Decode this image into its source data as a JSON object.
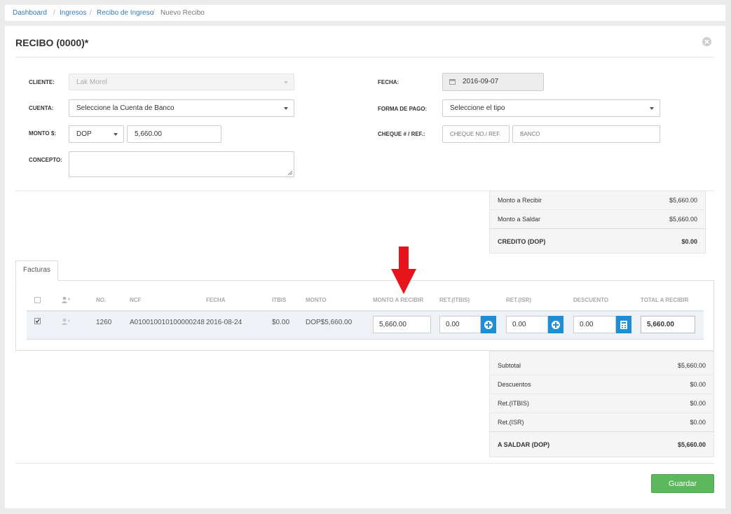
{
  "breadcrumb": [
    {
      "label": "Dashboard"
    },
    {
      "label": "Ingresos"
    },
    {
      "label": "Recibo de Ingreso"
    },
    {
      "label": "Nuevo Recibo"
    }
  ],
  "breadcrumb_separator": "/",
  "title": "RECIBO (0000)*",
  "form": {
    "cliente_label": "CLIENTE:",
    "cliente_value": "Lak Morel",
    "cuenta_label": "CUENTA:",
    "cuenta_value": "Seleccione la Cuenta de Banco",
    "monto_label": "MONTO $:",
    "currency_value": "DOP",
    "monto_value": "5,660.00",
    "concepto_label": "CONCEPTO:",
    "fecha_label": "FECHA:",
    "fecha_value": "2016-09-07",
    "forma_label": "FORMA DE PAGO:",
    "forma_value": "Seleccione el tipo",
    "cheque_label": "CHEQUE # / REF.:",
    "cheque_placeholder": "CHEQUE NO./ REF.",
    "banco_placeholder": "BANCO"
  },
  "summary_top": [
    {
      "label": "Monto a Recibir",
      "value": "$5,660.00"
    },
    {
      "label": "Monto a Saldar",
      "value": "$5,660.00"
    },
    {
      "label": "CREDITO (DOP)",
      "value": "$0.00"
    }
  ],
  "tab": "Facturas",
  "table": {
    "headers": [
      "NO.",
      "NCF",
      "FECHA",
      "ITBIS",
      "MONTO",
      "MONTO A RECIBIR",
      "RET.(ITBIS)",
      "RET.(ISR)",
      "DESCUENTO",
      "TOTAL A RECIBIR"
    ],
    "row": {
      "checked": true,
      "no": "1260",
      "ncf": "A010010010100000248",
      "fecha": "2016-08-24",
      "itbis": "$0.00",
      "monto": "DOP$5,660.00",
      "monto_recibir": "5,660.00",
      "ret_itbis": "0.00",
      "ret_isr": "0.00",
      "descuento": "0.00",
      "total_recibir": "5,660.00"
    }
  },
  "summary_bottom": [
    {
      "label": "Subtotal",
      "value": "$5,660.00"
    },
    {
      "label": "Descuentos",
      "value": "$0.00"
    },
    {
      "label": "Ret.(ITBIS)",
      "value": "$0.00"
    },
    {
      "label": "Ret.(ISR)",
      "value": "$0.00"
    },
    {
      "label": "A SALDAR (DOP)",
      "value": "$5,660.00"
    }
  ],
  "save_label": "Guardar",
  "colors": {
    "accent": "#1f8ed6",
    "save": "#5cb85c",
    "arrow": "#e8141b",
    "link": "#337ab7"
  },
  "icons": [
    "close-icon",
    "calendar-icon",
    "user-plus-icon",
    "plus-icon",
    "calculator-icon",
    "arrow-down-icon"
  ]
}
